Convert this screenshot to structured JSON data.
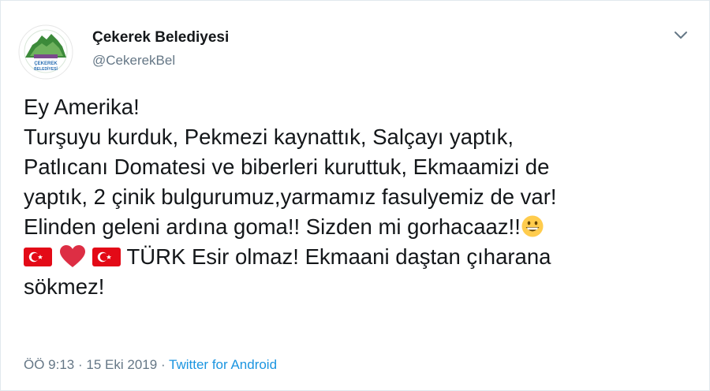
{
  "tweet": {
    "author": {
      "name": "Çekerek Belediyesi",
      "handle": "@CekerekBel",
      "avatar_text_line1": "ÇEKEREK",
      "avatar_text_line2": "BELEDİYESİ"
    },
    "text_lines": [
      "Ey Amerika!",
      "Turşuyu kurduk, Pekmezi kaynattık, Salçayı yaptık,",
      "Patlıcanı Domatesi ve biberleri kuruttuk, Ekmaamizi de",
      "yaptık, 2 çinik bulgurumuz,yarmamız fasulyemiz de var!",
      "Elinden geleni ardına goma!! Sizden mi gorhacaaz!!",
      "TÜRK Esir olmaz! Ekmaani daştan çıharana",
      "sökmez!"
    ],
    "emojis": [
      "grinning-face-icon",
      "turkish-flag-icon",
      "red-heart-icon",
      "turkish-flag-icon"
    ],
    "time": "ÖÖ 9:13",
    "separator": "·",
    "date": "15 Eki 2019",
    "source": "Twitter for Android"
  },
  "colors": {
    "text": "#14171a",
    "secondary": "#657786",
    "link": "#1b95e0",
    "border": "#e1e8ed",
    "flag_red": "#e30a17",
    "heart_red": "#dd2e44",
    "avatar_green": "#3c8a3a"
  }
}
